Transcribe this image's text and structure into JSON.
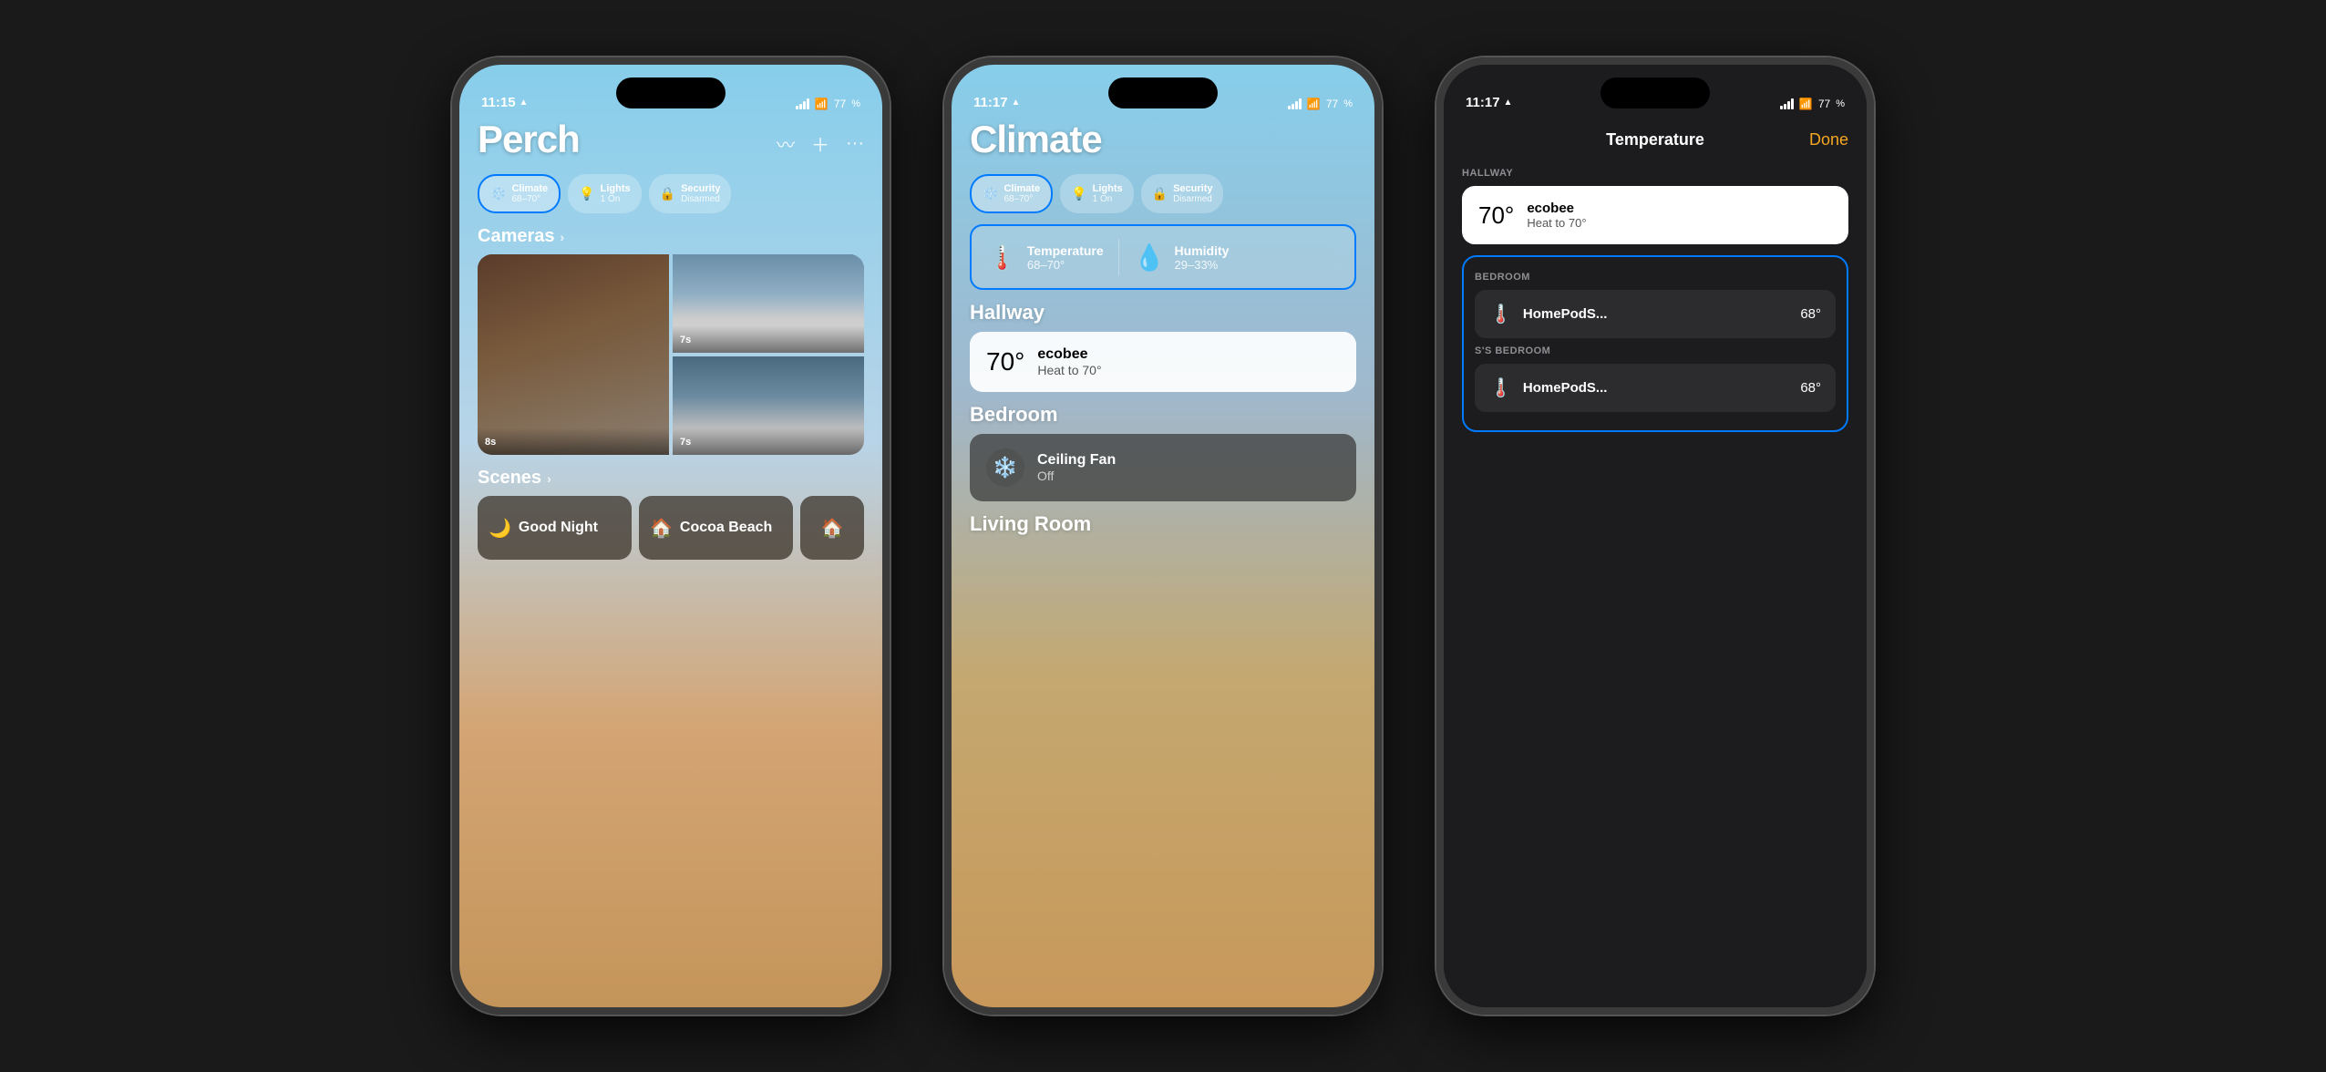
{
  "phone1": {
    "status_time": "11:15",
    "battery": "77",
    "title": "Perch",
    "tabs": [
      {
        "icon": "❄️",
        "label": "Climate",
        "sub": "68–70°",
        "active": true
      },
      {
        "icon": "💡",
        "label": "Lights",
        "sub": "1 On",
        "active": false
      },
      {
        "icon": "🔒",
        "label": "Security",
        "sub": "Disarmed",
        "active": false
      }
    ],
    "cameras_section": "Cameras",
    "cameras": [
      {
        "timer": "8s"
      },
      {
        "timer": "7s"
      },
      {
        "timer": "7s"
      }
    ],
    "scenes_section": "Scenes",
    "scenes": [
      {
        "icon": "🌙",
        "label": "Good Night"
      },
      {
        "icon": "🏠",
        "label": "Cocoa Beach"
      },
      {
        "icon": "🏠",
        "label": ""
      }
    ]
  },
  "phone2": {
    "status_time": "11:17",
    "battery": "77",
    "title": "Climate",
    "tabs": [
      {
        "icon": "❄️",
        "label": "Climate",
        "sub": "68–70°",
        "active": true
      },
      {
        "icon": "💡",
        "label": "Lights",
        "sub": "1 On",
        "active": false
      },
      {
        "icon": "🔒",
        "label": "Security",
        "sub": "Disarmed",
        "active": false
      }
    ],
    "selected_items": [
      {
        "icon": "🌡️",
        "label": "Temperature",
        "sub": "68–70°"
      },
      {
        "icon": "💧",
        "label": "Humidity",
        "sub": "29–33%"
      }
    ],
    "rooms": [
      {
        "name": "Hallway",
        "devices": [
          {
            "type": "thermostat",
            "temp": "70°",
            "name": "ecobee",
            "sub": "Heat to 70°"
          }
        ]
      },
      {
        "name": "Bedroom",
        "devices": [
          {
            "type": "fan",
            "icon": "❄️",
            "name": "Ceiling Fan",
            "sub": "Off"
          }
        ]
      },
      {
        "name": "Living Room",
        "devices": []
      }
    ]
  },
  "phone3": {
    "status_time": "11:17",
    "battery": "77",
    "title": "Temperature",
    "done_label": "Done",
    "rooms": [
      {
        "section": "HALLWAY",
        "devices": [
          {
            "temp": "70°",
            "name": "ecobee",
            "sub": "Heat to 70°",
            "card_type": "light"
          }
        ]
      },
      {
        "section": "BEDROOM",
        "devices": [
          {
            "temp": "68°",
            "name": "HomePodS...",
            "card_type": "dark"
          }
        ]
      },
      {
        "section": "S'S BEDROOM",
        "devices": [
          {
            "temp": "68°",
            "name": "HomePodS...",
            "card_type": "dark"
          }
        ]
      }
    ]
  }
}
